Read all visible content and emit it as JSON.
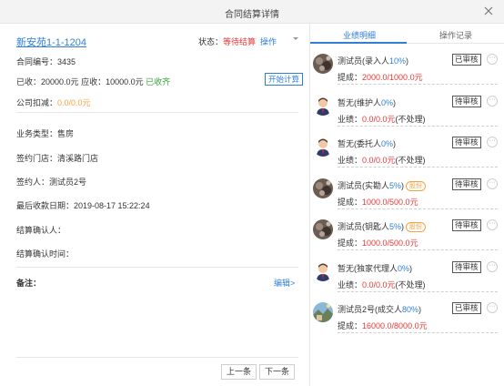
{
  "dialog": {
    "title": "合同结算详情"
  },
  "left": {
    "house": "新安苑1-1-1204",
    "status_label": "状态：",
    "status_value": "等待结算",
    "ops_label": "操作",
    "contract": "合同编号：3435",
    "received": "已收：20000.0元",
    "receivable": "应收：10000.0元",
    "received_all": "已收齐",
    "calc_button": "开始计算",
    "deduct_label": "公司扣减：",
    "deduct_value": "0.0/0.0元",
    "biz_type": "业务类型：售房",
    "store": "签约门店：清溪路门店",
    "signer": "签约人：测试员2号",
    "last_date": "最后收款日期：2019-08-17 15:22:24",
    "confirm_person": "结算确认人：",
    "confirm_time": "结算确认时间：",
    "remarks": "备注：",
    "edit": "编辑>",
    "prev": "上一条",
    "next": "下一条"
  },
  "right": {
    "tabs": [
      "业绩明细",
      "操作记录"
    ],
    "cards": [
      {
        "name": "测试员(录入人",
        "pct": "10%",
        "close": ")",
        "badge": "",
        "prefix": "提成：",
        "value": "2000.0/1000.0元",
        "suffix": "",
        "status": "已审核",
        "avatar": "photo"
      },
      {
        "name": "暂无(维护人",
        "pct": "0%",
        "close": ")",
        "badge": "",
        "prefix": "业绩：",
        "value": "0.0/0.0元",
        "suffix": "(不处理)",
        "status": "待审核",
        "avatar": "person"
      },
      {
        "name": "暂无(委托人",
        "pct": "0%",
        "close": ")",
        "badge": "",
        "prefix": "业绩：",
        "value": "0.0/0.0元",
        "suffix": "(不处理)",
        "status": "待审核",
        "avatar": "person"
      },
      {
        "name": "测试员(实勘人",
        "pct": "5%",
        "close": ")",
        "badge": "股份",
        "prefix": "提成：",
        "value": "1000.0/500.0元",
        "suffix": "",
        "status": "待审核",
        "avatar": "photo"
      },
      {
        "name": "测试员(钥匙人",
        "pct": "5%",
        "close": ")",
        "badge": "股份",
        "prefix": "提成：",
        "value": "1000.0/500.0元",
        "suffix": "",
        "status": "待审核",
        "avatar": "photo"
      },
      {
        "name": "暂无(独家代理人",
        "pct": "0%",
        "close": ")",
        "badge": "",
        "prefix": "业绩：",
        "value": "0.0/0.0元",
        "suffix": "(不处理)",
        "status": "待审核",
        "avatar": "person"
      },
      {
        "name": "测试员2号(成交人",
        "pct": "80%",
        "close": ")",
        "badge": "",
        "prefix": "提成：",
        "value": "16000.0/8000.0元",
        "suffix": "",
        "status": "已审核",
        "avatar": "landscape"
      }
    ]
  },
  "colors": {
    "link": "#2f7fd6",
    "alert": "#e53935",
    "success": "#3aa83a",
    "warning": "#f5a342"
  }
}
